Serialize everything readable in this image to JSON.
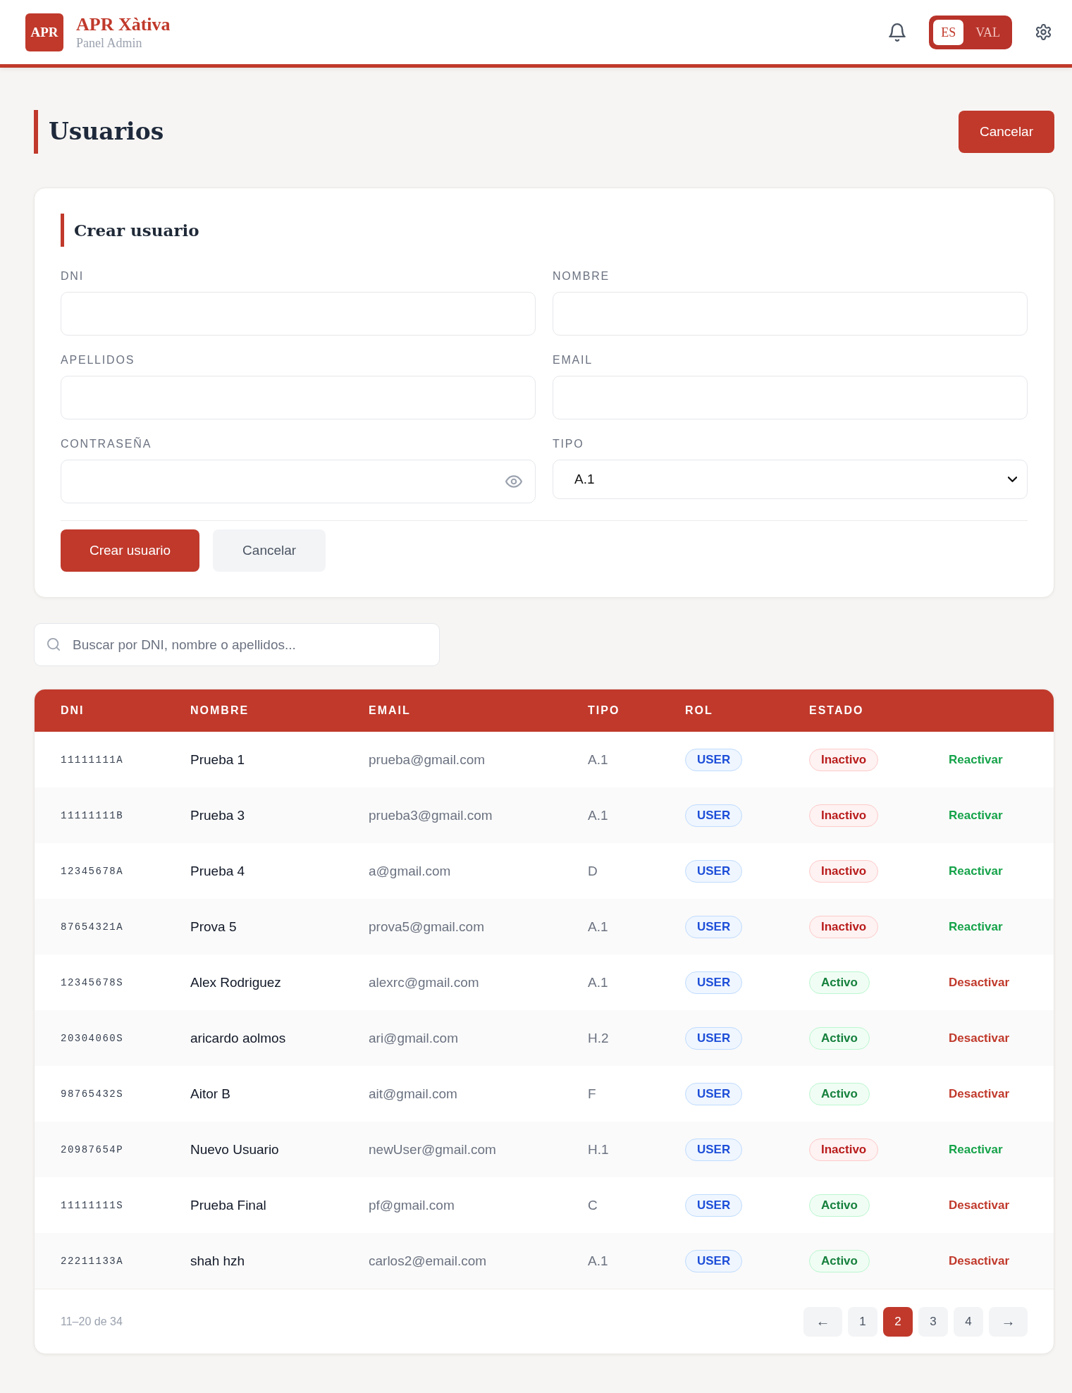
{
  "header": {
    "logo": "APR",
    "title": "APR Xàtiva",
    "subtitle": "Panel Admin",
    "languages": [
      {
        "label": "ES",
        "selected": true
      },
      {
        "label": "VAL",
        "selected": false
      }
    ]
  },
  "page": {
    "title": "Usuarios",
    "cancel_button": "Cancelar"
  },
  "form": {
    "title": "Crear usuario",
    "fields": [
      {
        "kind": "text",
        "label": "DNI"
      },
      {
        "kind": "text",
        "label": "NOMBRE"
      },
      {
        "kind": "text",
        "label": "APELLIDOS"
      },
      {
        "kind": "text",
        "label": "EMAIL"
      },
      {
        "kind": "password",
        "label": "CONTRASEÑA"
      },
      {
        "kind": "select",
        "label": "TIPO",
        "value": "A.1"
      }
    ],
    "buttons": [
      {
        "kind": "primary",
        "label": "Crear usuario"
      },
      {
        "kind": "secondary",
        "label": "Cancelar"
      }
    ]
  },
  "search": {
    "placeholder": "Buscar por DNI, nombre o apellidos..."
  },
  "table": {
    "columns": [
      "DNI",
      "NOMBRE",
      "EMAIL",
      "TIPO",
      "ROL",
      "ESTADO"
    ],
    "rows": [
      {
        "dni": "11111111A",
        "nombre": "Prueba 1",
        "email": "prueba@gmail.com",
        "tipo": "A.1",
        "rol": "USER",
        "estado": "Inactivo",
        "active": false,
        "action": "Reactivar"
      },
      {
        "dni": "11111111B",
        "nombre": "Prueba 3",
        "email": "prueba3@gmail.com",
        "tipo": "A.1",
        "rol": "USER",
        "estado": "Inactivo",
        "active": false,
        "action": "Reactivar"
      },
      {
        "dni": "12345678A",
        "nombre": "Prueba 4",
        "email": "a@gmail.com",
        "tipo": "D",
        "rol": "USER",
        "estado": "Inactivo",
        "active": false,
        "action": "Reactivar"
      },
      {
        "dni": "87654321A",
        "nombre": "Prova 5",
        "email": "prova5@gmail.com",
        "tipo": "A.1",
        "rol": "USER",
        "estado": "Inactivo",
        "active": false,
        "action": "Reactivar"
      },
      {
        "dni": "12345678S",
        "nombre": "Alex Rodriguez",
        "email": "alexrc@gmail.com",
        "tipo": "A.1",
        "rol": "USER",
        "estado": "Activo",
        "active": true,
        "action": "Desactivar"
      },
      {
        "dni": "20304060S",
        "nombre": "aricardo aolmos",
        "email": "ari@gmail.com",
        "tipo": "H.2",
        "rol": "USER",
        "estado": "Activo",
        "active": true,
        "action": "Desactivar"
      },
      {
        "dni": "98765432S",
        "nombre": "Aitor B",
        "email": "ait@gmail.com",
        "tipo": "F",
        "rol": "USER",
        "estado": "Activo",
        "active": true,
        "action": "Desactivar"
      },
      {
        "dni": "20987654P",
        "nombre": "Nuevo Usuario",
        "email": "newUser@gmail.com",
        "tipo": "H.1",
        "rol": "USER",
        "estado": "Inactivo",
        "active": false,
        "action": "Reactivar"
      },
      {
        "dni": "11111111S",
        "nombre": "Prueba Final",
        "email": "pf@gmail.com",
        "tipo": "C",
        "rol": "USER",
        "estado": "Activo",
        "active": true,
        "action": "Desactivar"
      },
      {
        "dni": "22211133A",
        "nombre": "shah hzh",
        "email": "carlos2@email.com",
        "tipo": "A.1",
        "rol": "USER",
        "estado": "Activo",
        "active": true,
        "action": "Desactivar"
      }
    ]
  },
  "pagination": {
    "summary": "11–20 de 34",
    "prev": "←",
    "next": "→",
    "pages": [
      {
        "label": "1",
        "selected": false
      },
      {
        "label": "2",
        "selected": true
      },
      {
        "label": "3",
        "selected": false
      },
      {
        "label": "4",
        "selected": false
      }
    ]
  }
}
